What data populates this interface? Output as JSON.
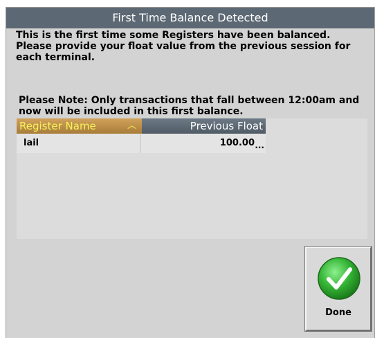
{
  "dialog": {
    "title": "First Time Balance Detected",
    "message": "This is the first time some Registers have been balanced. Please provide your float value from the previous session for each terminal.",
    "note": "Please Note: Only transactions that fall between 12:00am and now will be included in this first balance."
  },
  "grid": {
    "columns": {
      "register_name": "Register Name",
      "previous_float": "Previous Float"
    },
    "sort": {
      "column": "register_name",
      "direction": "ascending",
      "icon": "caret-up-icon"
    },
    "rows": [
      {
        "register_name": "lail",
        "previous_float": "100.00",
        "edit_glyph": "..."
      }
    ]
  },
  "actions": {
    "done_label": "Done",
    "done_icon": "checkmark-icon"
  },
  "colors": {
    "title_bar": "#5c6873",
    "header_selected": "#c0914c",
    "header_selected_text": "#f7f35c",
    "header": "#5c6873",
    "panel": "#d3d3d3",
    "done_green": "#2fae2f"
  }
}
